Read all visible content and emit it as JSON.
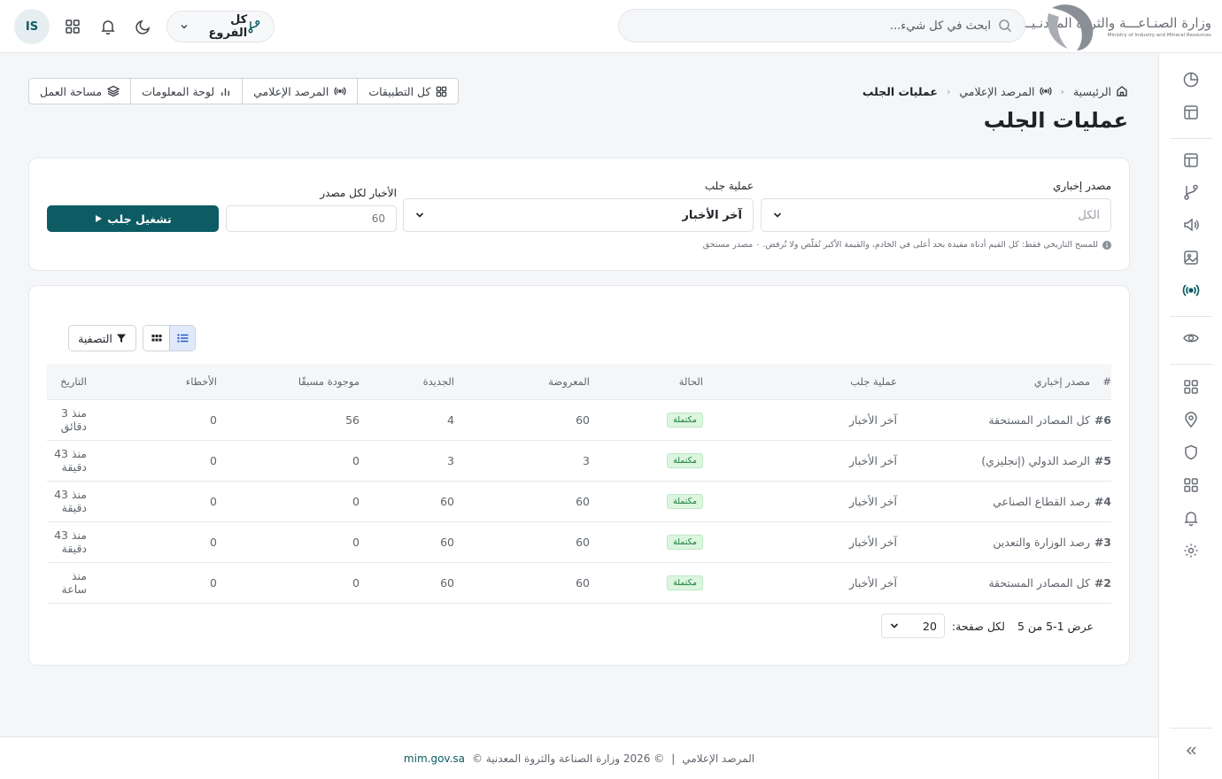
{
  "header": {
    "logo_ar": "وزارة الصنـاعـــة والثروة المعدنـيـــة",
    "logo_en": "Ministry of Industry and Mineral Resources",
    "search_placeholder": "ابحث في كل شيء...",
    "branch_label": "كل الفروع",
    "avatar_initials": "IS"
  },
  "breadcrumb": {
    "home": "الرئيسية",
    "section": "المرصد الإعلامي",
    "current": "عمليات الجلب"
  },
  "page_title": "عمليات الجلب",
  "quick_nav": {
    "all_apps": "كل التطبيقات",
    "observatory": "المرصد الإعلامي",
    "dashboard": "لوحة المعلومات",
    "workspace": "مساحة العمل"
  },
  "fetch_form": {
    "source_label": "مصدر إخباري",
    "source_value": "الكل",
    "operation_label": "عملية جلب",
    "operation_value": "آخر الأخبار",
    "per_source_label": "الأخبار لكل مصدر",
    "per_source_placeholder": "60",
    "run_button": "تشغيل جلب",
    "hint": "للمسح التاريخي فقط: كل القيم أدناه مقيدة بحد أعلى في الخادم، والقيمة الأكبر تُقلّص ولا تُرفض. ٠ مصدر مستحق"
  },
  "toolbar": {
    "filter_label": "التصفية"
  },
  "table": {
    "headers": [
      "#",
      "مصدر إخباري",
      "عملية جلب",
      "الحالة",
      "المعروضة",
      "الجديدة",
      "موجودة مسبقًا",
      "الأخطاء",
      "التاريخ"
    ],
    "rows": [
      {
        "id": "#6",
        "source": "كل المصادر المستحقة",
        "op": "آخر الأخبار",
        "status": "مكتملة",
        "shown": "60",
        "new": "4",
        "existing": "56",
        "errors": "0",
        "date": "منذ 3 دقائق"
      },
      {
        "id": "#5",
        "source": "الرصد الدولي (إنجليزي)",
        "op": "آخر الأخبار",
        "status": "مكتملة",
        "shown": "3",
        "new": "3",
        "existing": "0",
        "errors": "0",
        "date": "منذ 43 دقيقة"
      },
      {
        "id": "#4",
        "source": "رصد القطاع الصناعي",
        "op": "آخر الأخبار",
        "status": "مكتملة",
        "shown": "60",
        "new": "60",
        "existing": "0",
        "errors": "0",
        "date": "منذ 43 دقيقة"
      },
      {
        "id": "#3",
        "source": "رصد الوزارة والتعدين",
        "op": "آخر الأخبار",
        "status": "مكتملة",
        "shown": "60",
        "new": "60",
        "existing": "0",
        "errors": "0",
        "date": "منذ 43 دقيقة"
      },
      {
        "id": "#2",
        "source": "كل المصادر المستحقة",
        "op": "آخر الأخبار",
        "status": "مكتملة",
        "shown": "60",
        "new": "60",
        "existing": "0",
        "errors": "0",
        "date": "منذ ساعة"
      }
    ]
  },
  "pagination": {
    "summary": "عرض 1-5 من 5",
    "per_page_label": "لكل صفحة:",
    "per_page_value": "20"
  },
  "footer": {
    "section": "المرصد الإعلامي",
    "separator": "|",
    "copyright": "© 2026 وزارة الصناعة والثروة المعدنية ©",
    "link": "mim.gov.sa"
  },
  "colors": {
    "accent": "#0d5c63",
    "link": "#2152c9",
    "success_bg": "#dbf5df",
    "success_text": "#1b7d3a"
  }
}
